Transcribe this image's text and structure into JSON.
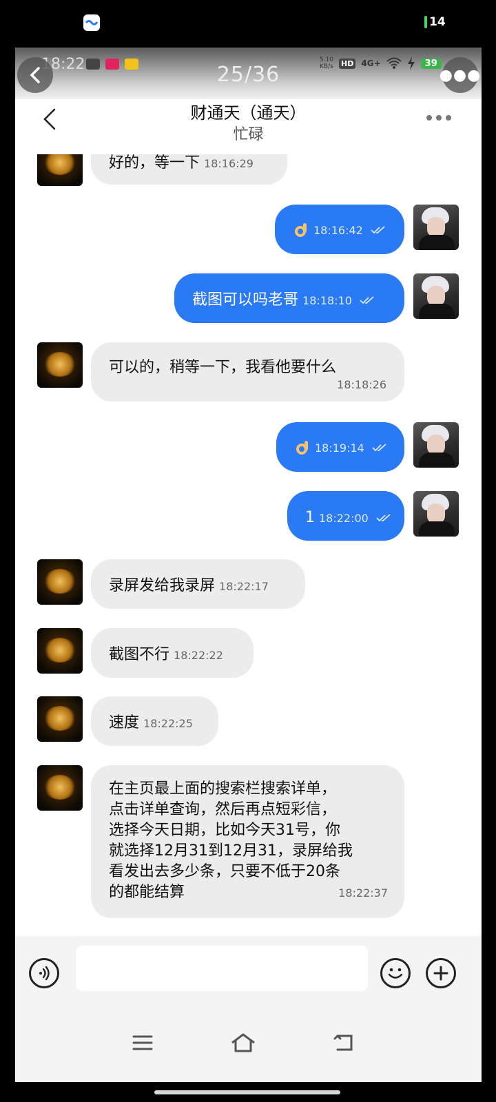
{
  "outer_status": {
    "battery": "14"
  },
  "viewer": {
    "counter": "25/36"
  },
  "inner_status": {
    "time": "18:22",
    "net_speed": "5.10\nKB/s",
    "hd": "HD",
    "net": "4G+",
    "battery": "39"
  },
  "chat": {
    "title": "财通天（通天）",
    "status": "忙碌"
  },
  "messages": [
    {
      "from": "contact",
      "text": "好的，等一下",
      "time": "18:16:29"
    },
    {
      "from": "me",
      "text": "",
      "emoji": "ok-hand",
      "time": "18:16:42",
      "read": true
    },
    {
      "from": "me",
      "text": "截图可以吗老哥",
      "time": "18:18:10",
      "read": true
    },
    {
      "from": "contact",
      "text": "可以的，稍等一下，我看他要什么",
      "time": "18:18:26"
    },
    {
      "from": "me",
      "text": "",
      "emoji": "ok-hand",
      "time": "18:19:14",
      "read": true
    },
    {
      "from": "me",
      "text": "1",
      "time": "18:22:00",
      "read": true
    },
    {
      "from": "contact",
      "text": "录屏发给我录屏",
      "time": "18:22:17"
    },
    {
      "from": "contact",
      "text": "截图不行",
      "time": "18:22:22"
    },
    {
      "from": "contact",
      "text": "速度",
      "time": "18:22:25"
    },
    {
      "from": "contact",
      "lines": [
        "在主页最上面的搜索栏搜索详单，",
        "点击详单查询，然后再点短彩信，",
        "选择今天日期，比如今天31号，你",
        "就选择12月31到12月31，录屏给我",
        "看发出去多少条，只要不低于20条",
        "的都能结算"
      ],
      "time": "18:22:37"
    }
  ],
  "input": {
    "placeholder": ""
  },
  "colors": {
    "outgoing": "#2a7af5",
    "incoming": "#ececec"
  }
}
